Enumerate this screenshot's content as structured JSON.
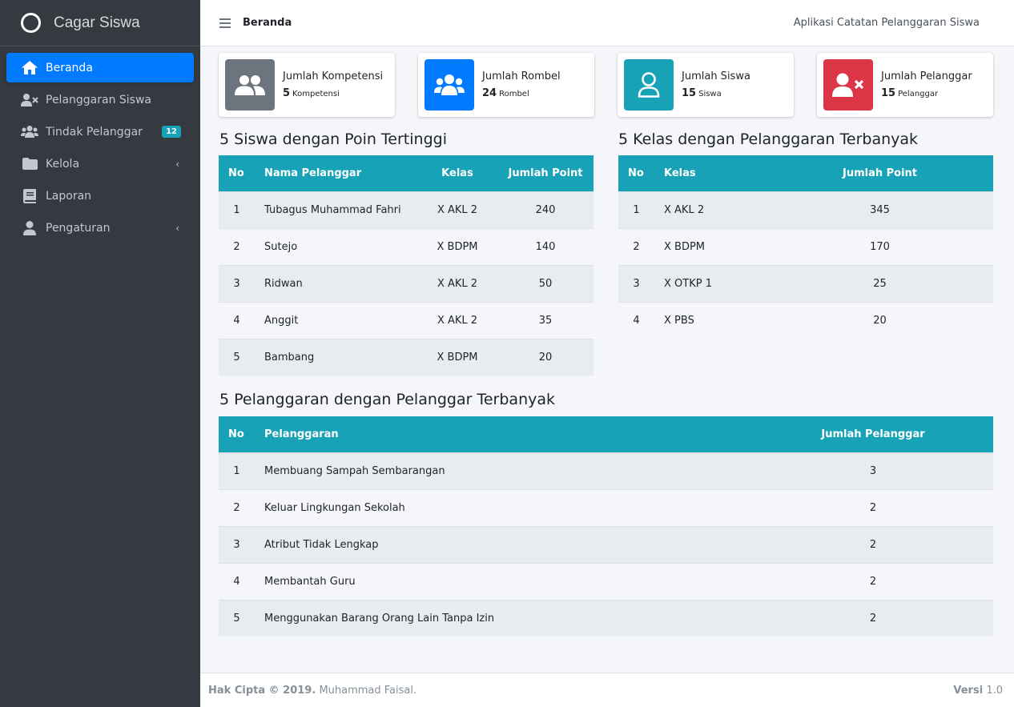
{
  "brand": {
    "name": "Cagar Siswa"
  },
  "sidebar": {
    "items": [
      {
        "label": "Beranda",
        "icon": "home-icon",
        "active": true
      },
      {
        "label": "Pelanggaran Siswa",
        "icon": "user-times-icon"
      },
      {
        "label": "Tindak Pelanggar",
        "icon": "users-icon",
        "badge": "12"
      },
      {
        "label": "Kelola",
        "icon": "folder-icon",
        "arrow": "‹"
      },
      {
        "label": "Laporan",
        "icon": "book-icon"
      },
      {
        "label": "Pengaturan",
        "icon": "user-icon",
        "arrow": "‹"
      }
    ]
  },
  "header": {
    "title": "Beranda",
    "app_name": "Aplikasi Catatan Pelanggaran Siswa"
  },
  "info_boxes": [
    {
      "title": "Jumlah Kompetensi",
      "value": "5",
      "unit": "Kompetensi",
      "color": "#6c757d",
      "icon": "users-icon"
    },
    {
      "title": "Jumlah Rombel",
      "value": "24",
      "unit": "Rombel",
      "color": "#007bff",
      "icon": "users-group-icon"
    },
    {
      "title": "Jumlah Siswa",
      "value": "15",
      "unit": "Siswa",
      "color": "#17a2b8",
      "icon": "user-icon"
    },
    {
      "title": "Jumlah Pelanggar",
      "value": "15",
      "unit": "Pelanggar",
      "color": "#dc3545",
      "icon": "user-times-icon"
    }
  ],
  "top_students": {
    "title": "5 Siswa dengan Poin Tertinggi",
    "headers": [
      "No",
      "Nama Pelanggar",
      "Kelas",
      "Jumlah Point"
    ],
    "rows": [
      [
        "1",
        "Tubagus Muhammad Fahri",
        "X AKL 2",
        "240"
      ],
      [
        "2",
        "Sutejo",
        "X BDPM",
        "140"
      ],
      [
        "3",
        "Ridwan",
        "X AKL 2",
        "50"
      ],
      [
        "4",
        "Anggit",
        "X AKL 2",
        "35"
      ],
      [
        "5",
        "Bambang",
        "X BDPM",
        "20"
      ]
    ]
  },
  "top_classes": {
    "title": "5 Kelas dengan Pelanggaran Terbanyak",
    "headers": [
      "No",
      "Kelas",
      "Jumlah Point"
    ],
    "rows": [
      [
        "1",
        "X AKL 2",
        "345"
      ],
      [
        "2",
        "X BDPM",
        "170"
      ],
      [
        "3",
        "X OTKP 1",
        "25"
      ],
      [
        "4",
        "X PBS",
        "20"
      ]
    ]
  },
  "top_violations": {
    "title": "5 Pelanggaran dengan Pelanggar Terbanyak",
    "headers": [
      "No",
      "Pelanggaran",
      "Jumlah Pelanggar"
    ],
    "rows": [
      [
        "1",
        "Membuang Sampah Sembarangan",
        "3"
      ],
      [
        "2",
        "Keluar Lingkungan Sekolah",
        "2"
      ],
      [
        "3",
        "Atribut Tidak Lengkap",
        "2"
      ],
      [
        "4",
        "Membantah Guru",
        "2"
      ],
      [
        "5",
        "Menggunakan Barang Orang Lain Tanpa Izin",
        "2"
      ]
    ]
  },
  "footer": {
    "copyright": "Hak Cipta © 2019.",
    "author": "Muhammad Faisal.",
    "version_label": "Versi",
    "version": "1.0"
  }
}
